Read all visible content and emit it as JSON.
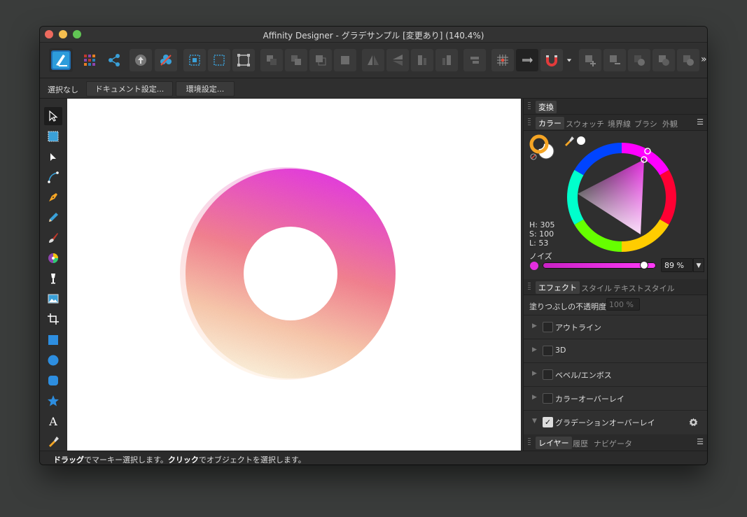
{
  "window": {
    "title": "Affinity Designer - グラデサンプル [変更あり] (140.4%)"
  },
  "context_toolbar": {
    "selection_label": "選択なし",
    "document_setup_label": "ドキュメント設定...",
    "preferences_label": "環境設定..."
  },
  "toolbar": {
    "overflow_label": "»"
  },
  "panels": {
    "transform": {
      "tab": "変換"
    },
    "color": {
      "tabs": [
        "カラー",
        "スウォッチ",
        "境界線",
        "ブラシ",
        "外観"
      ],
      "h_label": "H: 305",
      "s_label": "S: 100",
      "l_label": "L: 53",
      "noise_label": "ノイズ",
      "noise_value": "89 %",
      "noise_level": 0.89,
      "selected_color": "#e52ee0"
    },
    "effects": {
      "tabs": [
        "エフェクト",
        "スタイル",
        "テキストスタイル"
      ],
      "opacity_label": "塗りつぶしの不透明度:",
      "opacity_value": "100 %",
      "items": [
        {
          "label": "アウトライン",
          "checked": false
        },
        {
          "label": "3D",
          "checked": false
        },
        {
          "label": "ベベル/エンボス",
          "checked": false
        },
        {
          "label": "カラーオーバーレイ",
          "checked": false
        },
        {
          "label": "グラデーションオーバーレイ",
          "checked": true
        }
      ]
    },
    "layers": {
      "tabs": [
        "レイヤー",
        "履歴",
        "ナビゲータ"
      ]
    }
  },
  "status_bar": {
    "drag": "ドラッグ",
    "drag_text": "でマーキー選択します。",
    "click": "クリック",
    "click_text": "でオブジェクトを選択します。"
  },
  "icons": {
    "toolbar": [
      "persona-designer-icon",
      "pixel-persona-icon",
      "export-persona-icon",
      "move-back-icon",
      "move-forward-icon",
      "snapping-grid-icon",
      "align-icon",
      "flip-icon",
      "magnet-icon",
      "boolean-add-icon"
    ],
    "tools": [
      "move-tool-icon",
      "artboard-tool-icon",
      "node-tool-icon",
      "corner-tool-icon",
      "pen-tool-icon",
      "pencil-tool-icon",
      "brush-tool-icon",
      "fill-tool-icon",
      "transparency-tool-icon",
      "place-image-tool-icon",
      "crop-tool-icon",
      "rectangle-tool-icon",
      "ellipse-tool-icon",
      "rounded-rect-tool-icon",
      "star-tool-icon",
      "text-tool-icon",
      "color-picker-tool-icon"
    ]
  },
  "colors": {
    "accent": "#2d9cdb",
    "magenta": "#e52ee0",
    "orange": "#f5a524"
  }
}
